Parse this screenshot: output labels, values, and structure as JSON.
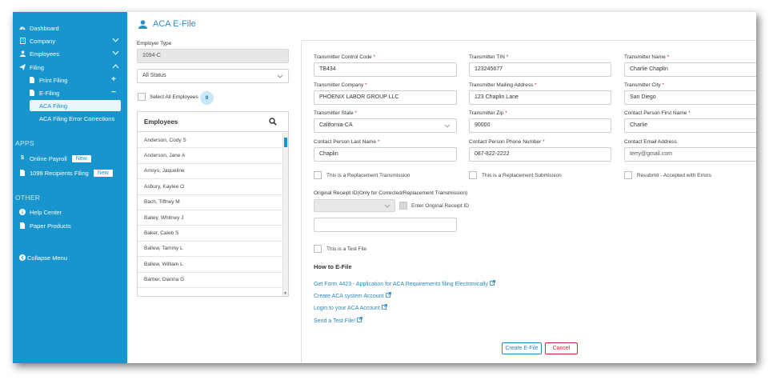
{
  "sidebar": {
    "items": [
      {
        "label": "Dashboard",
        "icon": "dashboard-icon"
      },
      {
        "label": "Company",
        "icon": "building-icon"
      },
      {
        "label": "Employees",
        "icon": "user-icon"
      },
      {
        "label": "Filing",
        "icon": "paper-plane-icon"
      },
      {
        "label": "Print Filing",
        "icon": "document-icon"
      },
      {
        "label": "E-Filing",
        "icon": "document-icon"
      },
      {
        "label": "ACA Filing"
      },
      {
        "label": "ACA Filing Error Corrections"
      }
    ],
    "apps_title": "APPS",
    "apps": [
      {
        "label": "Online Payroll",
        "badge": "New",
        "icon": "dollar-icon"
      },
      {
        "label": "1099 Recipients Filing",
        "badge": "New",
        "icon": "document-icon"
      }
    ],
    "other_title": "OTHER",
    "other": [
      {
        "label": "Help Center",
        "icon": "info-icon"
      },
      {
        "label": "Paper Products",
        "icon": "document-icon"
      }
    ],
    "collapse_label": "Collapse Menu"
  },
  "page": {
    "title": "ACA E-File",
    "employer_type_label": "Employer Type",
    "employer_type_value": "1094-C",
    "status_filter": "All Status",
    "select_all_label": "Select All Employees",
    "selected_count": "0",
    "employees_header": "Employees",
    "employees": [
      "Anderson, Cody S",
      "Anderson, Jane A",
      "Arroyo, Jaqueline",
      "Asbury, Kaylee O",
      "Bach, Tiffney M",
      "Bailey, Whitney J",
      "Baker, Caleb S",
      "Ballew, Tammy L",
      "Ballew, William L",
      "Barber, Dianna G"
    ]
  },
  "form": {
    "fields": {
      "control_code": {
        "label": "Transmitter Control Code",
        "value": "TB434"
      },
      "tin": {
        "label": "Transmitter TIN",
        "value": "123245677"
      },
      "name": {
        "label": "Transmitter Name",
        "value": "Charlie Chaplin"
      },
      "company": {
        "label": "Transmitter Company",
        "value": "PHOENIX LABOR GROUP LLC"
      },
      "mailing": {
        "label": "Transmitter Mailing Address",
        "value": "123 Chaplin Lane"
      },
      "city": {
        "label": "Transmitter City",
        "value": "San Diego"
      },
      "state": {
        "label": "Transmitter State",
        "value": "California-CA"
      },
      "zip": {
        "label": "Transmitter Zip",
        "value": "90000"
      },
      "first_name": {
        "label": "Contact Person First Name",
        "value": "Charlie"
      },
      "last_name": {
        "label": "Contact Person Last Name",
        "value": "Chaplin"
      },
      "phone": {
        "label": "Contact Person Phone Number",
        "value": "087-822-2222"
      },
      "email": {
        "label": "Contact Email Address",
        "placeholder": "terry@gmail.com"
      }
    },
    "required_mark": "*",
    "checkboxes": {
      "replacement_transmission": "This is a Replacement Transmission",
      "replacement_submission": "This is a Replacement Submission",
      "resubmit": "Resubmit - Accepted with Errors",
      "enter_receipt": "Enter Original Receipt ID",
      "test_file": "This is a Test File"
    },
    "receipt_label": "Original Receipt ID(Only for Corrected/Replacement Transmission)",
    "how_to_title": "How to E-File",
    "links": [
      "Get Form 4423 - Application for ACA Requirements filing Electronically",
      "Create ACA system Account",
      "Login to your ACA Account",
      "Send a Test File!"
    ],
    "create_button": "Create E-File",
    "cancel_button": "Cancel"
  },
  "colors": {
    "sidebar": "#1795cc",
    "accent": "#2a86bd",
    "required": "#d9262e"
  }
}
